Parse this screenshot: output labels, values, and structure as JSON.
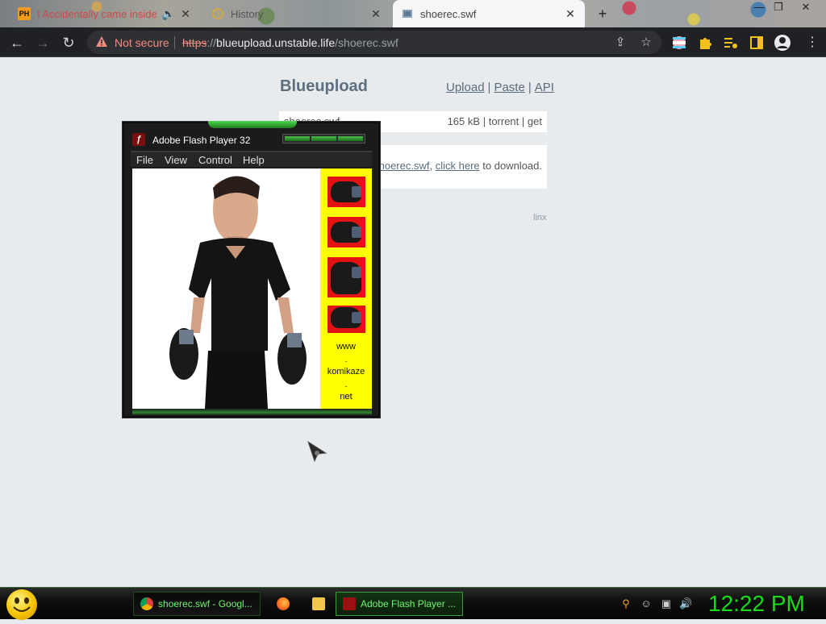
{
  "browser": {
    "tabs": [
      {
        "title": "I Accidentally came inside n",
        "favicon": "pornhub-favicon",
        "badge": "PH",
        "audio": true
      },
      {
        "title": "History",
        "favicon": "history-favicon"
      },
      {
        "title": "shoerec.swf",
        "favicon": "page-favicon",
        "active": true
      }
    ],
    "new_tab_symbol": "+",
    "window_controls": {
      "minimize": "—",
      "restore": "❐",
      "close": "✕"
    },
    "toolbar": {
      "security_label": "Not secure",
      "url_scheme": "https",
      "url_sep": "://",
      "url_host": "blueupload.unstable.life",
      "url_path": "/shoerec.swf"
    }
  },
  "page": {
    "brand": "Blueupload",
    "nav": {
      "upload": "Upload",
      "sep": "|",
      "paste": "Paste",
      "api": "API"
    },
    "file": {
      "name": "shoerec.swf",
      "size": "165 kB",
      "sep": "|",
      "torrent": "torrent",
      "get": "get"
    },
    "message": {
      "file_link": "hoerec.swf",
      "comma": ",",
      "click_here": "click here",
      "suffix": " to download."
    },
    "footer": "linx"
  },
  "flash_window": {
    "title": "Adobe Flash Player 32",
    "logo": "ƒ",
    "menu": [
      "File",
      "View",
      "Control",
      "Help"
    ],
    "sidebar_text": [
      "www",
      ".",
      "komikaze",
      ".",
      "net"
    ]
  },
  "taskbar": {
    "tasks": [
      {
        "label": "shoerec.swf - Googl...",
        "icon": "chrome-icon"
      },
      {
        "label": "Adobe Flash Player ...",
        "icon": "flash-icon"
      }
    ],
    "clock": "12:22 PM"
  },
  "colors": {
    "accent_green": "#1bd91b",
    "not_secure_red": "#f28b82",
    "flash_yellow": "#ffff00",
    "flash_red": "#e31313"
  }
}
